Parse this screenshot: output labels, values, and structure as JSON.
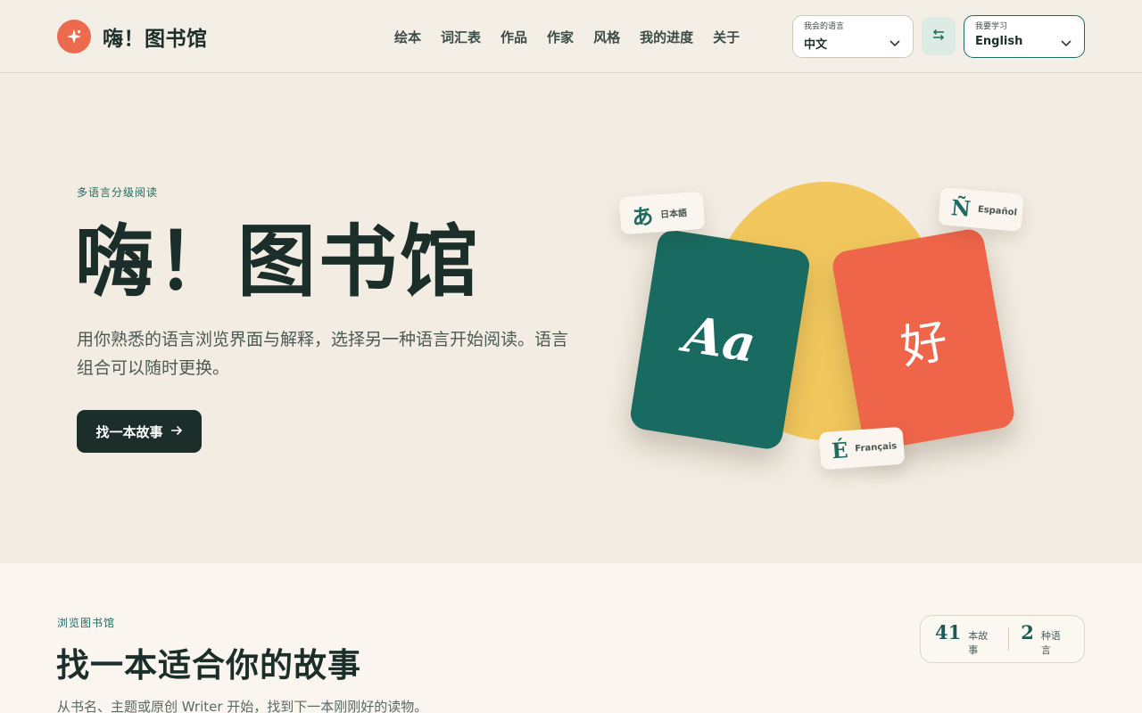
{
  "header": {
    "brand": "嗨！图书馆",
    "nav": [
      "绘本",
      "词汇表",
      "作品",
      "作家",
      "风格",
      "我的进度",
      "关于"
    ],
    "from_language": {
      "caption": "我会的语言",
      "value": "中文"
    },
    "to_language": {
      "caption": "我要学习",
      "value": "English"
    }
  },
  "hero": {
    "eyebrow": "多语言分级阅读",
    "title": "嗨！图书馆",
    "description": "用你熟悉的语言浏览界面与解释，选择另一种语言开始阅读。语言组合可以随时更换。",
    "cta": "找一本故事",
    "art": {
      "card_left": "Aa",
      "card_right": "好",
      "chips": [
        {
          "glyph": "あ",
          "label": "日本語"
        },
        {
          "glyph": "Ñ",
          "label": "Español"
        },
        {
          "glyph": "É",
          "label": "Français"
        }
      ]
    }
  },
  "browse": {
    "eyebrow": "浏览图书馆",
    "title": "找一本适合你的故事",
    "description": "从书名、主题或原创 Writer 开始，找到下一本刚刚好的读物。",
    "stats": [
      {
        "number": "41",
        "unit": "本故事"
      },
      {
        "number": "2",
        "unit": "种语言"
      }
    ]
  },
  "colors": {
    "brand_coral": "#ec6a4e",
    "accent_teal": "#1d6b61",
    "dark": "#1b2e2a",
    "sun_yellow": "#f2c75d",
    "page_bg": "#f2ece2"
  }
}
